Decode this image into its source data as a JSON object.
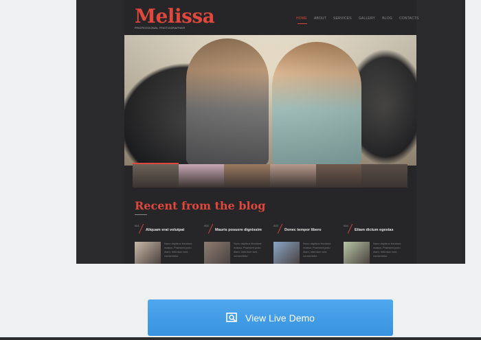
{
  "site": {
    "logo": "Melissa",
    "tagline": "Professional photographer",
    "nav": [
      "Home",
      "About",
      "Services",
      "Gallery",
      "Blog",
      "Contacts"
    ],
    "active_nav": "Home",
    "accent_color": "#e0473d"
  },
  "thumbnails": [
    {
      "name": "couple-motorcycle",
      "color": "#6b6359"
    },
    {
      "name": "woman-umbrella",
      "color": "#c7a7b4"
    },
    {
      "name": "woman-portrait-warm",
      "color": "#9a7a5f"
    },
    {
      "name": "couple-studio",
      "color": "#b89a8d"
    },
    {
      "name": "woman-portrait-dark",
      "color": "#6f5a4e"
    },
    {
      "name": "woman-hair",
      "color": "#5a4d47"
    }
  ],
  "blog": {
    "heading": "Recent from the blog",
    "posts": [
      {
        "num": "001",
        "title": "Aliquam erat volutpat",
        "image_color": "#c9b8a6",
        "excerpt": "Nunc dapibus tincidunt massa. Praesent justo diam, interdum sed, consectetur"
      },
      {
        "num": "002",
        "title": "Mauris posuere dignissim",
        "image_color": "#8c7d72",
        "excerpt": "Nunc dapibus tincidunt massa. Praesent justo diam, interdum sed, consectetur"
      },
      {
        "num": "003",
        "title": "Donec tempor libero",
        "image_color": "#8aa6c9",
        "excerpt": "Nunc dapibus tincidunt massa. Praesent justo diam, interdum sed, consectetur"
      },
      {
        "num": "004",
        "title": "Etiam dictum egestas",
        "image_color": "#b7c6a3",
        "excerpt": "Nunc dapibus tincidunt massa. Praesent justo diam, interdum sed, consectetur"
      }
    ]
  },
  "demo_button": {
    "label": "View Live Demo",
    "icon": "magnifier-window-icon",
    "color": "#3f9be6"
  }
}
